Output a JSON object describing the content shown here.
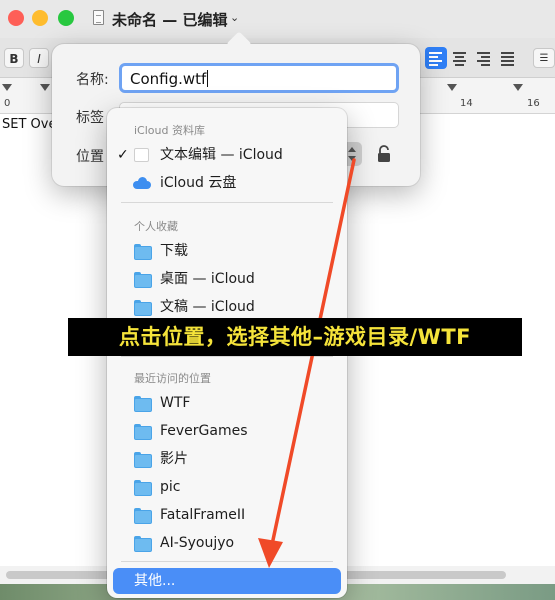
{
  "window": {
    "title": "未命名 — 已编辑",
    "title_chevron": "⌄"
  },
  "toolbar": {
    "bold": "B",
    "italic": "I"
  },
  "ruler": {
    "left": "0",
    "n14": "14",
    "n16": "16"
  },
  "document": {
    "text": "SET Ove"
  },
  "save_sheet": {
    "name_label": "名称:",
    "name_value": "Config.wtf",
    "tags_label": "标签",
    "location_label": "位置"
  },
  "menu": {
    "icloud_header": "iCloud 资料库",
    "icloud_items": [
      {
        "label": "文本编辑 — iCloud",
        "icon": "document-icon",
        "checked": true
      },
      {
        "label": "iCloud 云盘",
        "icon": "cloud-icon"
      }
    ],
    "favorites_header": "个人收藏",
    "favorites_items": [
      {
        "label": "下载",
        "icon": "folder-icon"
      },
      {
        "label": "桌面 — iCloud",
        "icon": "folder-icon"
      },
      {
        "label": "文稿 — iCloud",
        "icon": "folder-icon"
      }
    ],
    "recent_header": "最近访问的位置",
    "recent_items": [
      {
        "label": "WTF",
        "icon": "folder-icon"
      },
      {
        "label": "FeverGames",
        "icon": "folder-icon"
      },
      {
        "label": "影片",
        "icon": "folder-icon"
      },
      {
        "label": "pic",
        "icon": "folder-icon"
      },
      {
        "label": "FatalFrameII",
        "icon": "folder-icon"
      },
      {
        "label": "AI-Syoujyo",
        "icon": "folder-icon"
      }
    ],
    "other_label": "其他...",
    "checkmark": "✓"
  },
  "annotation": {
    "text": "点击位置，选择其他–游戏目录/WTF"
  },
  "colors": {
    "accent": "#4a8ef7",
    "annotation_text": "#f5e33a",
    "arrow": "#f04a28"
  }
}
